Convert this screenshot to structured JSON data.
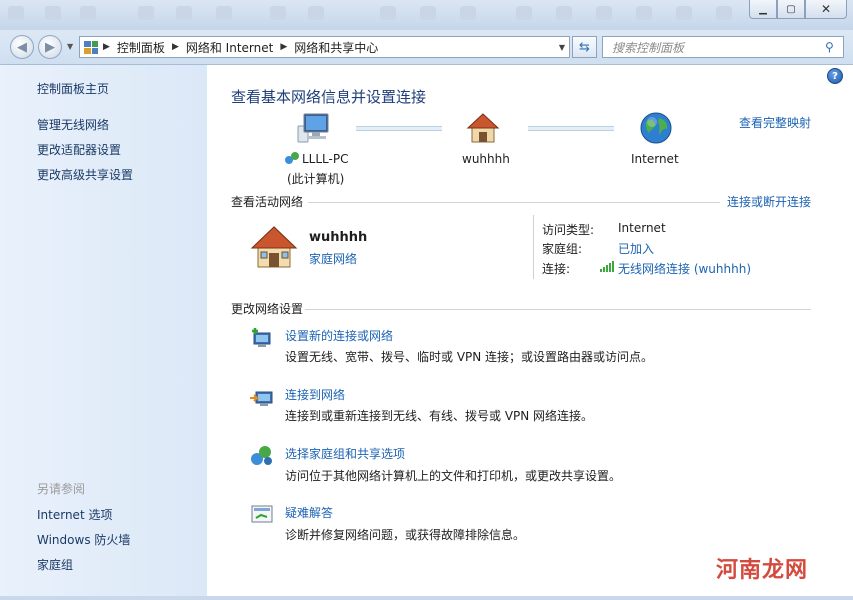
{
  "window": {
    "controls": {
      "minimize_icon": "minimize-icon",
      "maximize_icon": "maximize-icon",
      "close_icon": "close-icon"
    }
  },
  "address_bar": {
    "crumbs": [
      "控制面板",
      "网络和 Internet",
      "网络和共享中心"
    ]
  },
  "search": {
    "placeholder": "搜索控制面板"
  },
  "sidebar": {
    "home": "控制面板主页",
    "links": [
      "管理无线网络",
      "更改适配器设置",
      "更改高级共享设置"
    ],
    "see_also_title": "另请参阅",
    "see_also": [
      "Internet 选项",
      "Windows 防火墙",
      "家庭组"
    ]
  },
  "main": {
    "title": "查看基本网络信息并设置连接",
    "full_map_link": "查看完整映射",
    "map": {
      "computer_name": "LLLL-PC",
      "computer_sub": "(此计算机)",
      "network_name": "wuhhhh",
      "internet_label": "Internet"
    },
    "active_networks": {
      "heading": "查看活动网络",
      "connect_link": "连接或断开连接",
      "network_name": "wuhhhh",
      "network_type": "家庭网络",
      "access_type_label": "访问类型:",
      "access_type_value": "Internet",
      "homegroup_label": "家庭组:",
      "homegroup_value": "已加入",
      "connection_label": "连接:",
      "connection_value": "无线网络连接 (wuhhhh)"
    },
    "change_settings": {
      "heading": "更改网络设置",
      "items": [
        {
          "title": "设置新的连接或网络",
          "desc": "设置无线、宽带、拨号、临时或 VPN 连接；或设置路由器或访问点。"
        },
        {
          "title": "连接到网络",
          "desc": "连接到或重新连接到无线、有线、拨号或 VPN 网络连接。"
        },
        {
          "title": "选择家庭组和共享选项",
          "desc": "访问位于其他网络计算机上的文件和打印机，或更改共享设置。"
        },
        {
          "title": "疑难解答",
          "desc": "诊断并修复网络问题，或获得故障排除信息。"
        }
      ]
    }
  },
  "watermark": "河南龙网"
}
